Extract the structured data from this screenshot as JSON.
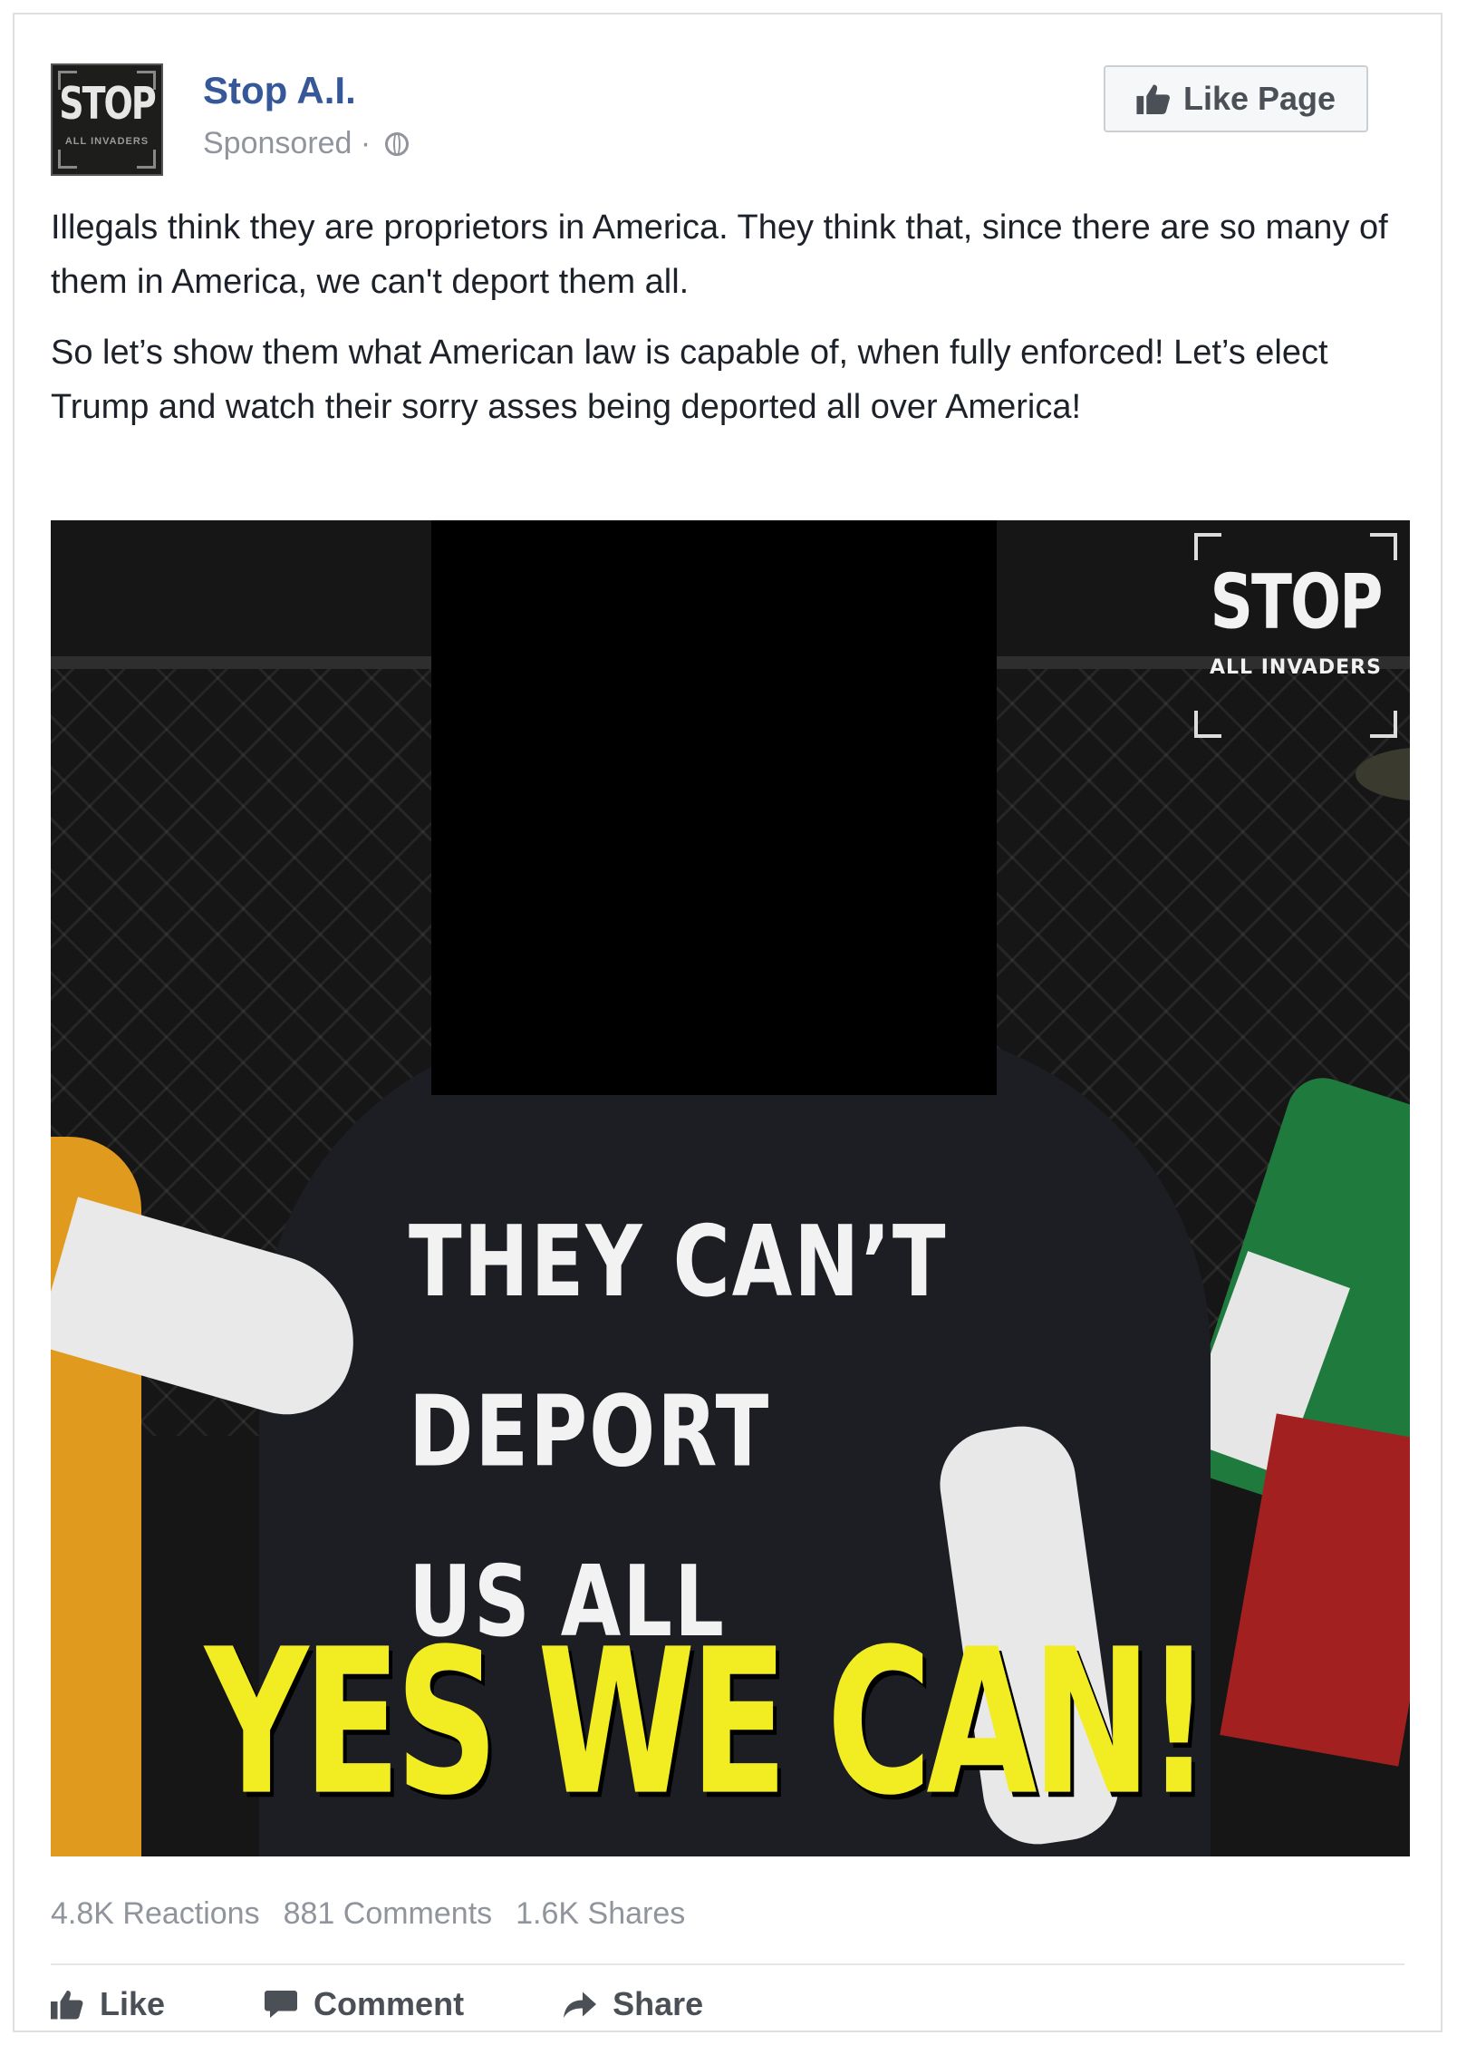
{
  "post": {
    "page_name": "Stop A.I.",
    "sponsored": "Sponsored",
    "separator": "·",
    "avatar_text": "STOP",
    "avatar_subtext": "ALL INVADERS",
    "like_page_label": "Like Page",
    "text_paragraphs": [
      "Illegals think they are proprietors in America. They think that, since there are so many of them in America, we can't deport them all.",
      "So let’s show them what American law is capable of, when fully enforced! Let’s elect Trump and watch their sorry asses being deported all over America!"
    ]
  },
  "image": {
    "logo_title": "STOP",
    "logo_subtitle": "ALL INVADERS",
    "shirt_lines": [
      "THEY CAN’T",
      "DEPORT",
      "US ALL"
    ],
    "caption": "YES WE CAN!"
  },
  "stats": {
    "reactions": "4.8K Reactions",
    "comments": "881 Comments",
    "shares": "1.6K Shares"
  },
  "actions": {
    "like": "Like",
    "comment": "Comment",
    "share": "Share"
  },
  "colors": {
    "link_blue": "#365899",
    "meta_gray": "#90949c",
    "caption_yellow": "#f2ec23"
  }
}
